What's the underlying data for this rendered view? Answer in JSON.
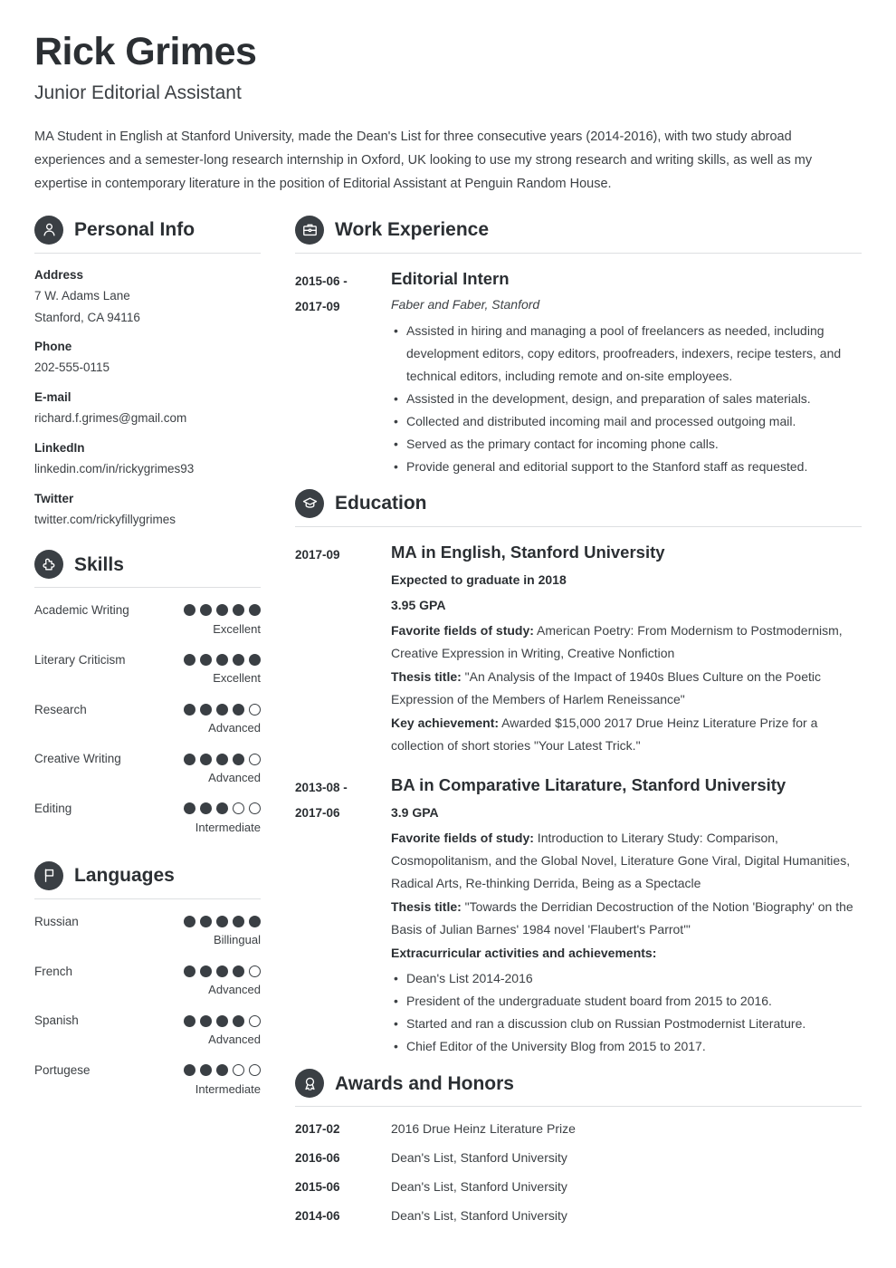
{
  "header": {
    "name": "Rick Grimes",
    "job_title": "Junior Editorial Assistant",
    "summary": "MA Student in English at Stanford University, made the Dean's List for three consecutive years (2014-2016), with two study abroad experiences and a semester-long research internship in Oxford, UK looking to use my strong research and writing skills, as well as my expertise in contemporary literature in the position of Editorial Assistant at Penguin Random House."
  },
  "colors": {
    "icon_circle": "#3a3f44",
    "heading_text": "#2b2f33",
    "body_text": "#3d4145",
    "rule": "#dddfe1",
    "page_background": "#ffffff"
  },
  "personal_info": {
    "section_title": "Personal Info",
    "icon": "person-icon",
    "fields": [
      {
        "label": "Address",
        "values": [
          "7 W. Adams Lane",
          "Stanford, CA 94116"
        ]
      },
      {
        "label": "Phone",
        "values": [
          "202-555-0115"
        ]
      },
      {
        "label": "E-mail",
        "values": [
          "richard.f.grimes@gmail.com"
        ]
      },
      {
        "label": "LinkedIn",
        "values": [
          "linkedin.com/in/rickygrimes93"
        ]
      },
      {
        "label": "Twitter",
        "values": [
          "twitter.com/rickyfillygrimes"
        ]
      }
    ]
  },
  "skills": {
    "section_title": "Skills",
    "icon": "puzzle-piece-icon",
    "max_dots": 5,
    "items": [
      {
        "name": "Academic Writing",
        "rating": 5,
        "level": "Excellent"
      },
      {
        "name": "Literary Criticism",
        "rating": 5,
        "level": "Excellent"
      },
      {
        "name": "Research",
        "rating": 4,
        "level": "Advanced"
      },
      {
        "name": "Creative Writing",
        "rating": 4,
        "level": "Advanced"
      },
      {
        "name": "Editing",
        "rating": 3,
        "level": "Intermediate"
      }
    ]
  },
  "languages": {
    "section_title": "Languages",
    "icon": "flag-icon",
    "max_dots": 5,
    "items": [
      {
        "name": "Russian",
        "rating": 5,
        "level": "Billingual"
      },
      {
        "name": "French",
        "rating": 4,
        "level": "Advanced"
      },
      {
        "name": "Spanish",
        "rating": 4,
        "level": "Advanced"
      },
      {
        "name": "Portugese",
        "rating": 3,
        "level": "Intermediate"
      }
    ]
  },
  "work_experience": {
    "section_title": "Work Experience",
    "icon": "briefcase-icon",
    "entries": [
      {
        "date_from": "2015-06 -",
        "date_to": "2017-09",
        "title": "Editorial Intern",
        "employer": "Faber and Faber, Stanford",
        "bullets": [
          "Assisted in hiring and managing a pool of freelancers as needed, including development editors, copy editors, proofreaders, indexers, recipe testers, and technical editors, including remote and on-site employees.",
          "Assisted in the development, design, and preparation of sales materials.",
          "Collected and distributed incoming mail and processed outgoing mail.",
          "Served as the primary contact for incoming phone calls.",
          "Provide general and editorial support to the Stanford staff as requested."
        ]
      }
    ]
  },
  "education": {
    "section_title": "Education",
    "icon": "graduation-cap-icon",
    "entries": [
      {
        "date_from": "2017-09",
        "date_to": "",
        "title": "MA in English, Stanford University",
        "strong_lines": [
          "Expected to graduate in 2018",
          "3.95 GPA"
        ],
        "detail_lines": [
          {
            "label": "Favorite fields of study:",
            "text": " American Poetry: From Modernism to Postmodernism, Creative Expression in Writing, Creative Nonfiction"
          },
          {
            "label": "Thesis title:",
            "text": " \"An Analysis of the Impact of 1940s Blues Culture on the Poetic Expression of the Members of Harlem Reneissance\""
          },
          {
            "label": "Key achievement:",
            "text": " Awarded $15,000 2017 Drue Heinz Literature Prize for a collection of short stories \"Your Latest Trick.\""
          }
        ],
        "bullets_heading": "",
        "bullets": []
      },
      {
        "date_from": "2013-08 -",
        "date_to": "2017-06",
        "title": "BA in Comparative Litarature, Stanford University",
        "strong_lines": [
          "3.9 GPA"
        ],
        "detail_lines": [
          {
            "label": "Favorite fields of study:",
            "text": " Introduction to Literary Study: Comparison, Cosmopolitanism, and the Global Novel, Literature Gone Viral, Digital Humanities, Radical Arts, Re-thinking Derrida, Being as a Spectacle"
          },
          {
            "label": "Thesis title:",
            "text": " \"Towards the Derridian Decostruction of the Notion 'Biography' on the Basis of Julian Barnes' 1984 novel 'Flaubert's Parrot'\""
          }
        ],
        "bullets_heading": "Extracurricular activities and achievements:",
        "bullets": [
          "Dean's List 2014-2016",
          "President of the undergraduate student board from 2015 to 2016.",
          "Started and ran a discussion club on Russian Postmodernist Literature.",
          "Chief Editor of the University Blog from 2015 to 2017."
        ]
      }
    ]
  },
  "awards": {
    "section_title": "Awards and Honors",
    "icon": "award-medal-icon",
    "items": [
      {
        "date": "2017-02",
        "text": "2016 Drue Heinz Literature Prize"
      },
      {
        "date": "2016-06",
        "text": "Dean's List, Stanford University"
      },
      {
        "date": "2015-06",
        "text": "Dean's List, Stanford University"
      },
      {
        "date": "2014-06",
        "text": "Dean's List, Stanford University"
      }
    ]
  }
}
